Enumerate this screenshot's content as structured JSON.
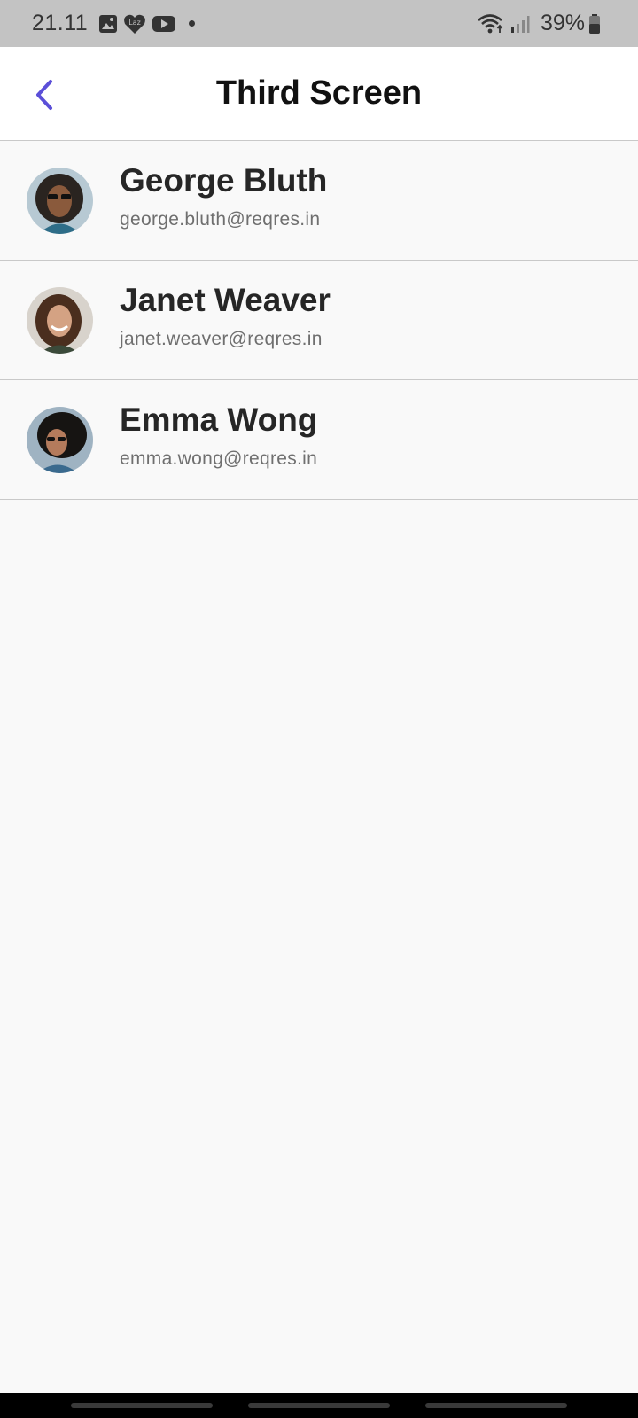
{
  "status_bar": {
    "time": "21.11",
    "notification_icons": [
      "gallery-icon",
      "lazada-icon",
      "youtube-icon"
    ],
    "battery_percent": "39%",
    "lazada_text": "Laz"
  },
  "app_bar": {
    "title": "Third Screen",
    "back_icon": "chevron-left-icon",
    "accent_color": "#5b4fd8"
  },
  "users": [
    {
      "name": "George Bluth",
      "email": "george.bluth@reqres.in"
    },
    {
      "name": "Janet Weaver",
      "email": "janet.weaver@reqres.in"
    },
    {
      "name": "Emma Wong",
      "email": "emma.wong@reqres.in"
    }
  ]
}
